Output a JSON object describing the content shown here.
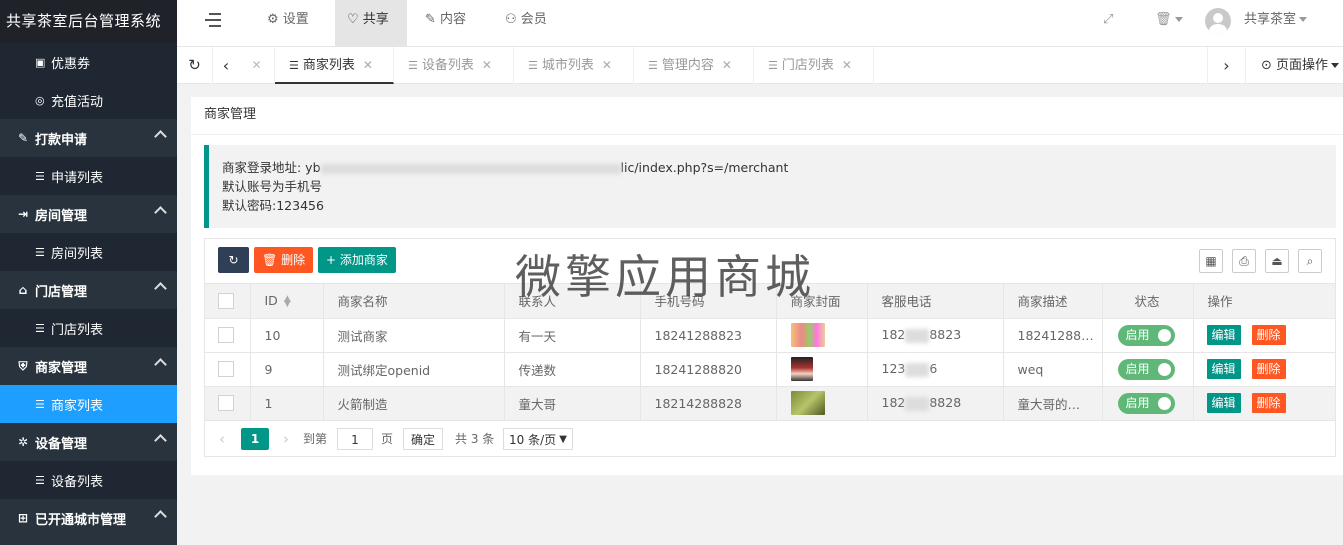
{
  "app": {
    "title": "共享茶室后台管理系统"
  },
  "sidebar": {
    "items": [
      {
        "type": "sub",
        "label": "优惠券",
        "icon": "coupon-icon"
      },
      {
        "type": "sub",
        "label": "充值活动",
        "icon": "recharge-icon"
      },
      {
        "type": "group",
        "label": "打款申请",
        "icon": "edit-icon"
      },
      {
        "type": "sub",
        "label": "申请列表",
        "icon": "list-icon"
      },
      {
        "type": "group",
        "label": "房间管理",
        "icon": "room-icon"
      },
      {
        "type": "sub",
        "label": "房间列表",
        "icon": "list-icon"
      },
      {
        "type": "group",
        "label": "门店管理",
        "icon": "home-icon"
      },
      {
        "type": "sub",
        "label": "门店列表",
        "icon": "list-icon"
      },
      {
        "type": "group",
        "label": "商家管理",
        "icon": "shield-icon"
      },
      {
        "type": "sub",
        "label": "商家列表",
        "icon": "list-icon",
        "active": true
      },
      {
        "type": "group",
        "label": "设备管理",
        "icon": "device-icon"
      },
      {
        "type": "sub",
        "label": "设备列表",
        "icon": "list-icon"
      },
      {
        "type": "group",
        "label": "已开通城市管理",
        "icon": "grid-icon"
      }
    ]
  },
  "header": {
    "nav": [
      {
        "label": "设置",
        "icon": "gear-icon"
      },
      {
        "label": "共享",
        "icon": "heart-icon",
        "active": true
      },
      {
        "label": "内容",
        "icon": "edit-icon"
      },
      {
        "label": "会员",
        "icon": "user-icon"
      }
    ],
    "user_name": "共享茶室"
  },
  "tabs": {
    "items": [
      {
        "label": "商家列表",
        "active": true
      },
      {
        "label": "设备列表"
      },
      {
        "label": "城市列表"
      },
      {
        "label": "管理内容"
      },
      {
        "label": "门店列表"
      }
    ],
    "page_ops": "页面操作"
  },
  "card": {
    "title": "商家管理",
    "notice": {
      "login_prefix": "商家登录地址: yb",
      "login_suffix": "lic/index.php?s=/merchant",
      "line2": "默认账号为手机号",
      "line3": "默认密码:123456"
    }
  },
  "toolbar": {
    "delete_label": "删除",
    "add_label": "添加商家"
  },
  "watermark": "微擎应用商城",
  "table": {
    "columns": [
      "ID",
      "商家名称",
      "联系人",
      "手机号码",
      "商家封面",
      "客服电话",
      "商家描述",
      "状态",
      "操作"
    ],
    "rows": [
      {
        "id": "10",
        "name": "测试商家",
        "contact": "有一天",
        "phone": "18241288823",
        "service_a": "182",
        "service_b": "8823",
        "desc": "18241288…",
        "status": "启用"
      },
      {
        "id": "9",
        "name": "测试绑定openid",
        "contact": "传递数",
        "phone": "18241288820",
        "service_a": "123",
        "service_b": "6",
        "desc": "weq",
        "status": "启用"
      },
      {
        "id": "1",
        "name": "火箭制造",
        "contact": "童大哥",
        "phone": "18214288828",
        "service_a": "182",
        "service_b": "8828",
        "desc": "童大哥的…",
        "status": "启用"
      }
    ],
    "edit_label": "编辑",
    "delete_label": "删除"
  },
  "pager": {
    "current": "1",
    "goto_label": "到第",
    "goto_value": "1",
    "page_unit": "页",
    "confirm": "确定",
    "total": "共 3 条",
    "per_page": "10 条/页"
  },
  "colors": {
    "sidebar_bg": "#28333e",
    "active_blue": "#1e9fff",
    "teal": "#009688",
    "orange": "#ff5722",
    "green_switch": "#5fb878"
  }
}
